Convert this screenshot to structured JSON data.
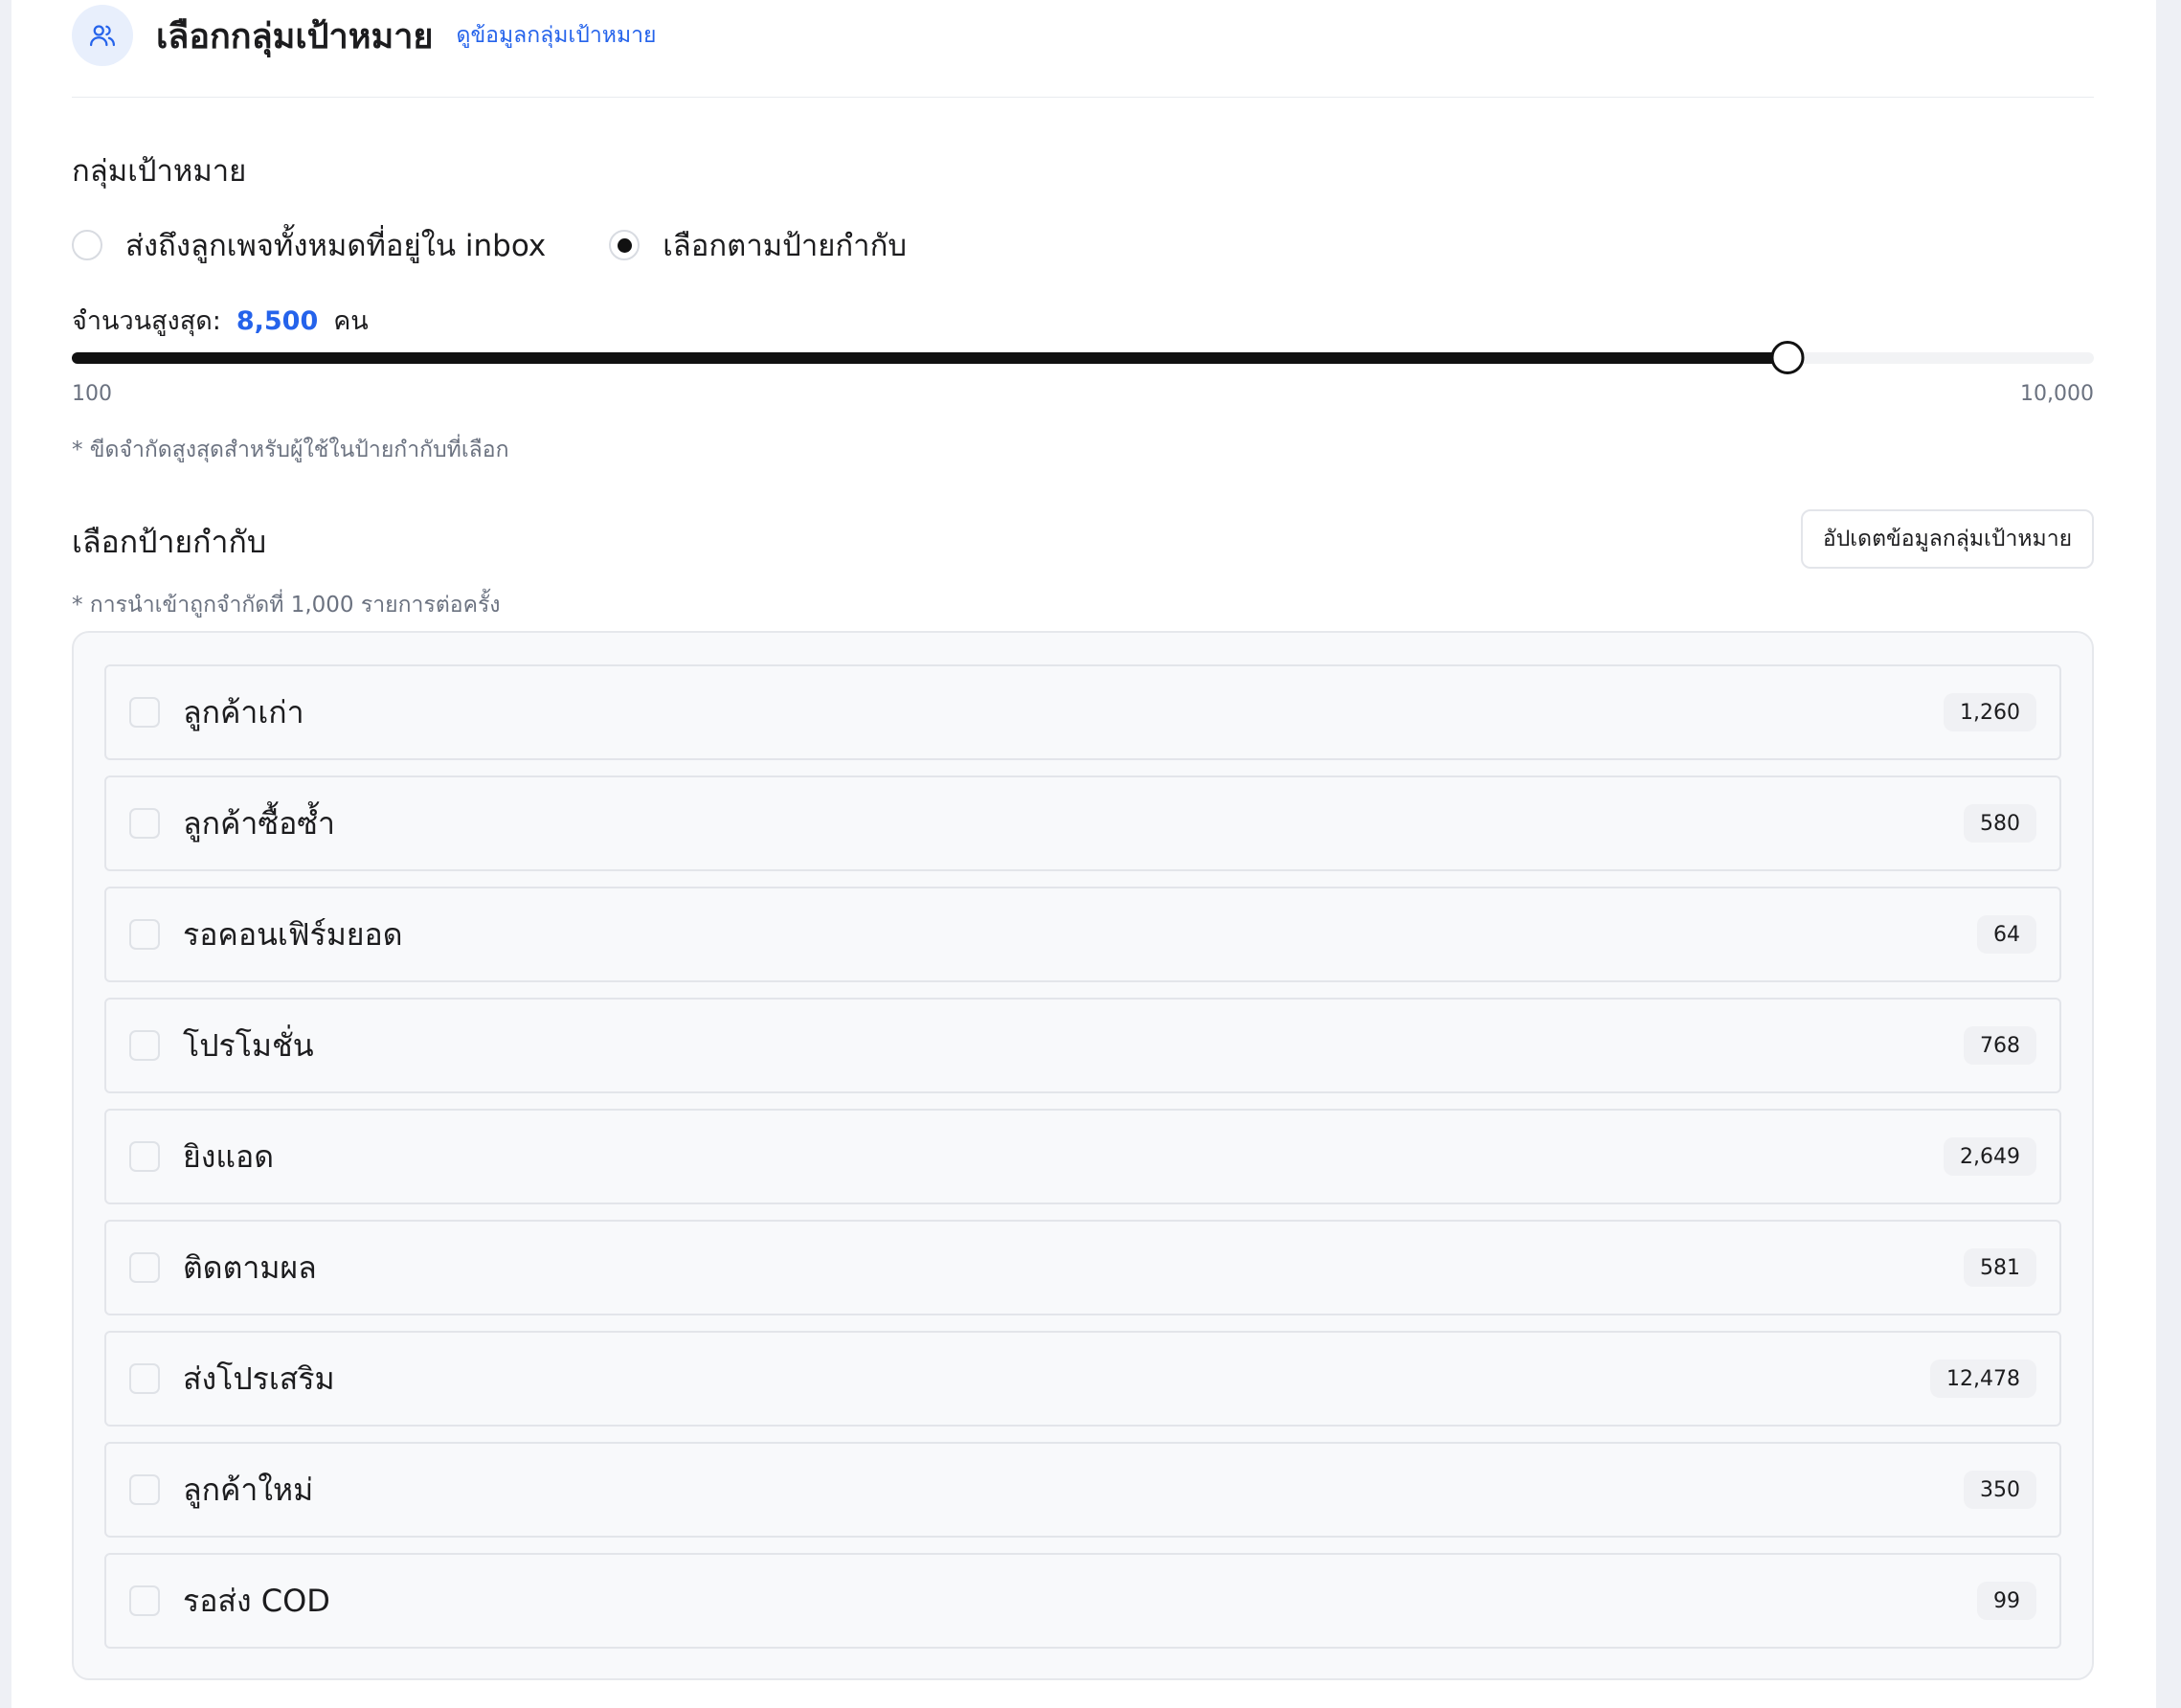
{
  "header": {
    "icon": "users-icon",
    "title": "เลือกกลุ่มเป้าหมาย",
    "link": "ดูข้อมูลกลุ่มเป้าหมาย"
  },
  "target_group": {
    "label": "กลุ่มเป้าหมาย",
    "options": [
      {
        "label": "ส่งถึงลูกเพจทั้งหมดที่อยู่ใน inbox",
        "selected": false
      },
      {
        "label": "เลือกตามป้ายกำกับ",
        "selected": true
      }
    ]
  },
  "max_count": {
    "label": "จำนวนสูงสุด:",
    "value": "8,500",
    "unit": "คน"
  },
  "slider": {
    "min_label": "100",
    "max_label": "10,000",
    "min": 100,
    "max": 10000,
    "value": 8500,
    "note": "* ขีดจำกัดสูงสุดสำหรับผู้ใช้ในป้ายกำกับที่เลือก"
  },
  "tags_section": {
    "title": "เลือกป้ายกำกับ",
    "update_button": "อัปเดตข้อมูลกลุ่มเป้าหมาย",
    "note": "* การนำเข้าถูกจำกัดที่ 1,000 รายการต่อครั้ง",
    "items": [
      {
        "label": "ลูกค้าเก่า",
        "count": "1,260",
        "checked": false
      },
      {
        "label": "ลูกค้าซื้อซ้ำ",
        "count": "580",
        "checked": false
      },
      {
        "label": "รอคอนเฟิร์มยอด",
        "count": "64",
        "checked": false
      },
      {
        "label": "โปรโมชั่น",
        "count": "768",
        "checked": false
      },
      {
        "label": "ยิงแอด",
        "count": "2,649",
        "checked": false
      },
      {
        "label": "ติดตามผล",
        "count": "581",
        "checked": false
      },
      {
        "label": "ส่งโปรเสริม",
        "count": "12,478",
        "checked": false
      },
      {
        "label": "ลูกค้าใหม่",
        "count": "350",
        "checked": false
      },
      {
        "label": "รอส่ง COD",
        "count": "99",
        "checked": false
      }
    ]
  },
  "colors": {
    "accent": "#2563eb",
    "slider_fill": "#111111",
    "icon_bg": "#e8effc"
  }
}
